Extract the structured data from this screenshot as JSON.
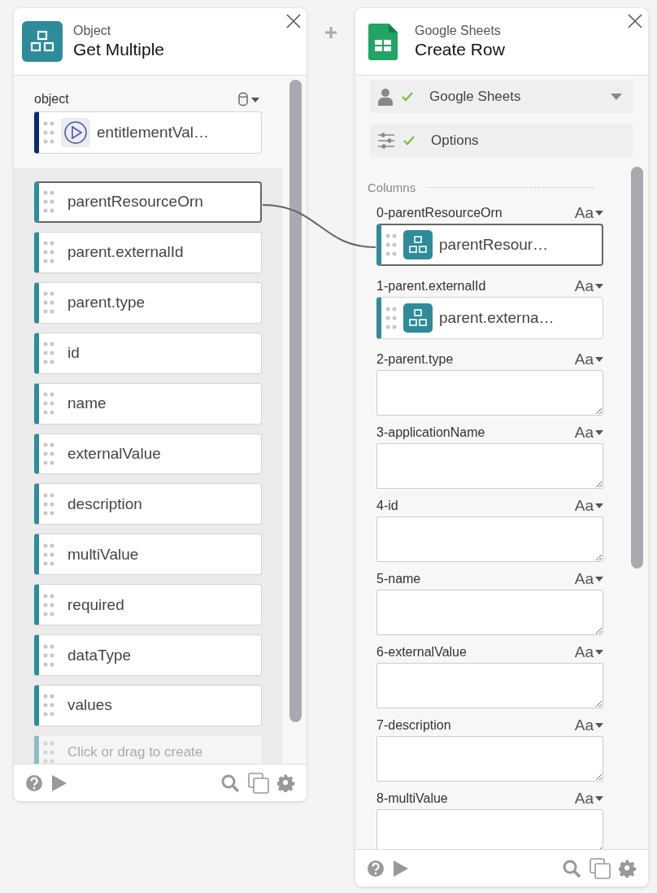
{
  "left_panel": {
    "category": "Object",
    "title": "Get Multiple",
    "object_field": {
      "label": "object",
      "value": "entitlementVal…"
    },
    "fields": [
      {
        "label": "parentResourceOrn",
        "selected": true
      },
      {
        "label": "parent.externalId",
        "selected": false
      },
      {
        "label": "parent.type",
        "selected": false
      },
      {
        "label": "id",
        "selected": false
      },
      {
        "label": "name",
        "selected": false
      },
      {
        "label": "externalValue",
        "selected": false
      },
      {
        "label": "description",
        "selected": false
      },
      {
        "label": "multiValue",
        "selected": false
      },
      {
        "label": "required",
        "selected": false
      },
      {
        "label": "dataType",
        "selected": false
      },
      {
        "label": "values",
        "selected": false
      }
    ],
    "create_placeholder": "Click or drag to create"
  },
  "right_panel": {
    "category": "Google Sheets",
    "title": "Create Row",
    "account": {
      "label": "Google Sheets",
      "ok": true
    },
    "options": {
      "label": "Options",
      "ok": true
    },
    "section": "Columns",
    "columns": [
      {
        "label": "0-parentResourceOrn",
        "type_label": "Aa",
        "kind": "mapped",
        "value": "parentResour…",
        "selected": true
      },
      {
        "label": "1-parent.externalId",
        "type_label": "Aa",
        "kind": "mapped",
        "value": "parent.externa…",
        "selected": false
      },
      {
        "label": "2-parent.type",
        "type_label": "Aa",
        "kind": "empty"
      },
      {
        "label": "3-applicationName",
        "type_label": "Aa",
        "kind": "empty"
      },
      {
        "label": "4-id",
        "type_label": "Aa",
        "kind": "empty"
      },
      {
        "label": "5-name",
        "type_label": "Aa",
        "kind": "empty"
      },
      {
        "label": "6-externalValue",
        "type_label": "Aa",
        "kind": "empty"
      },
      {
        "label": "7-description",
        "type_label": "Aa",
        "kind": "empty"
      },
      {
        "label": "8-multiValue",
        "type_label": "Aa",
        "kind": "empty"
      }
    ]
  }
}
